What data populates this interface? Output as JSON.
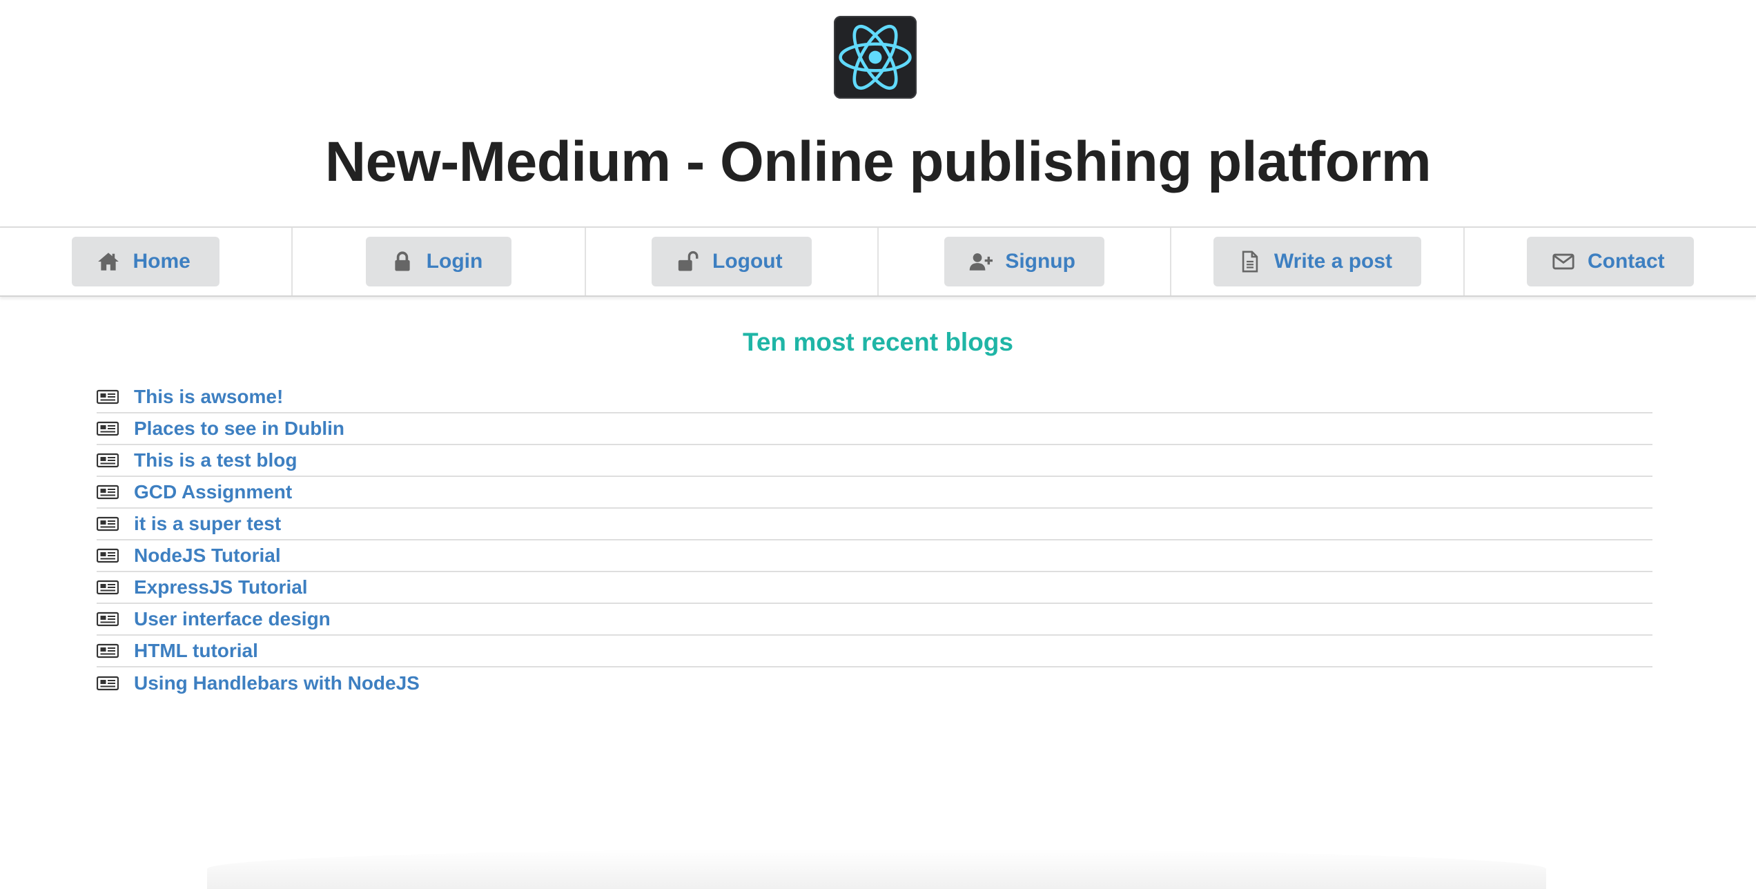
{
  "header": {
    "logo_icon": "react-atom-icon",
    "title": "New-Medium - Online publishing platform"
  },
  "nav": {
    "items": [
      {
        "label": "Home",
        "icon": "home-icon"
      },
      {
        "label": "Login",
        "icon": "lock-icon"
      },
      {
        "label": "Logout",
        "icon": "unlock-icon"
      },
      {
        "label": "Signup",
        "icon": "user-plus-icon"
      },
      {
        "label": "Write a post",
        "icon": "file-text-icon"
      },
      {
        "label": "Contact",
        "icon": "envelope-icon"
      }
    ]
  },
  "main": {
    "section_title": "Ten most recent blogs",
    "blogs": [
      {
        "title": "This is awsome!"
      },
      {
        "title": "Places to see in Dublin"
      },
      {
        "title": "This is a test blog"
      },
      {
        "title": "GCD Assignment"
      },
      {
        "title": "it is a super test"
      },
      {
        "title": "NodeJS Tutorial"
      },
      {
        "title": "ExpressJS Tutorial"
      },
      {
        "title": "User interface design"
      },
      {
        "title": "HTML tutorial"
      },
      {
        "title": "Using Handlebars with NodeJS"
      }
    ],
    "blog_icon": "newspaper-icon"
  },
  "colors": {
    "link": "#3d7fc1",
    "section_title": "#1fb5a6",
    "button_bg": "#e0e1e2",
    "logo_bg": "#222326",
    "react_blue": "#61dafb"
  }
}
